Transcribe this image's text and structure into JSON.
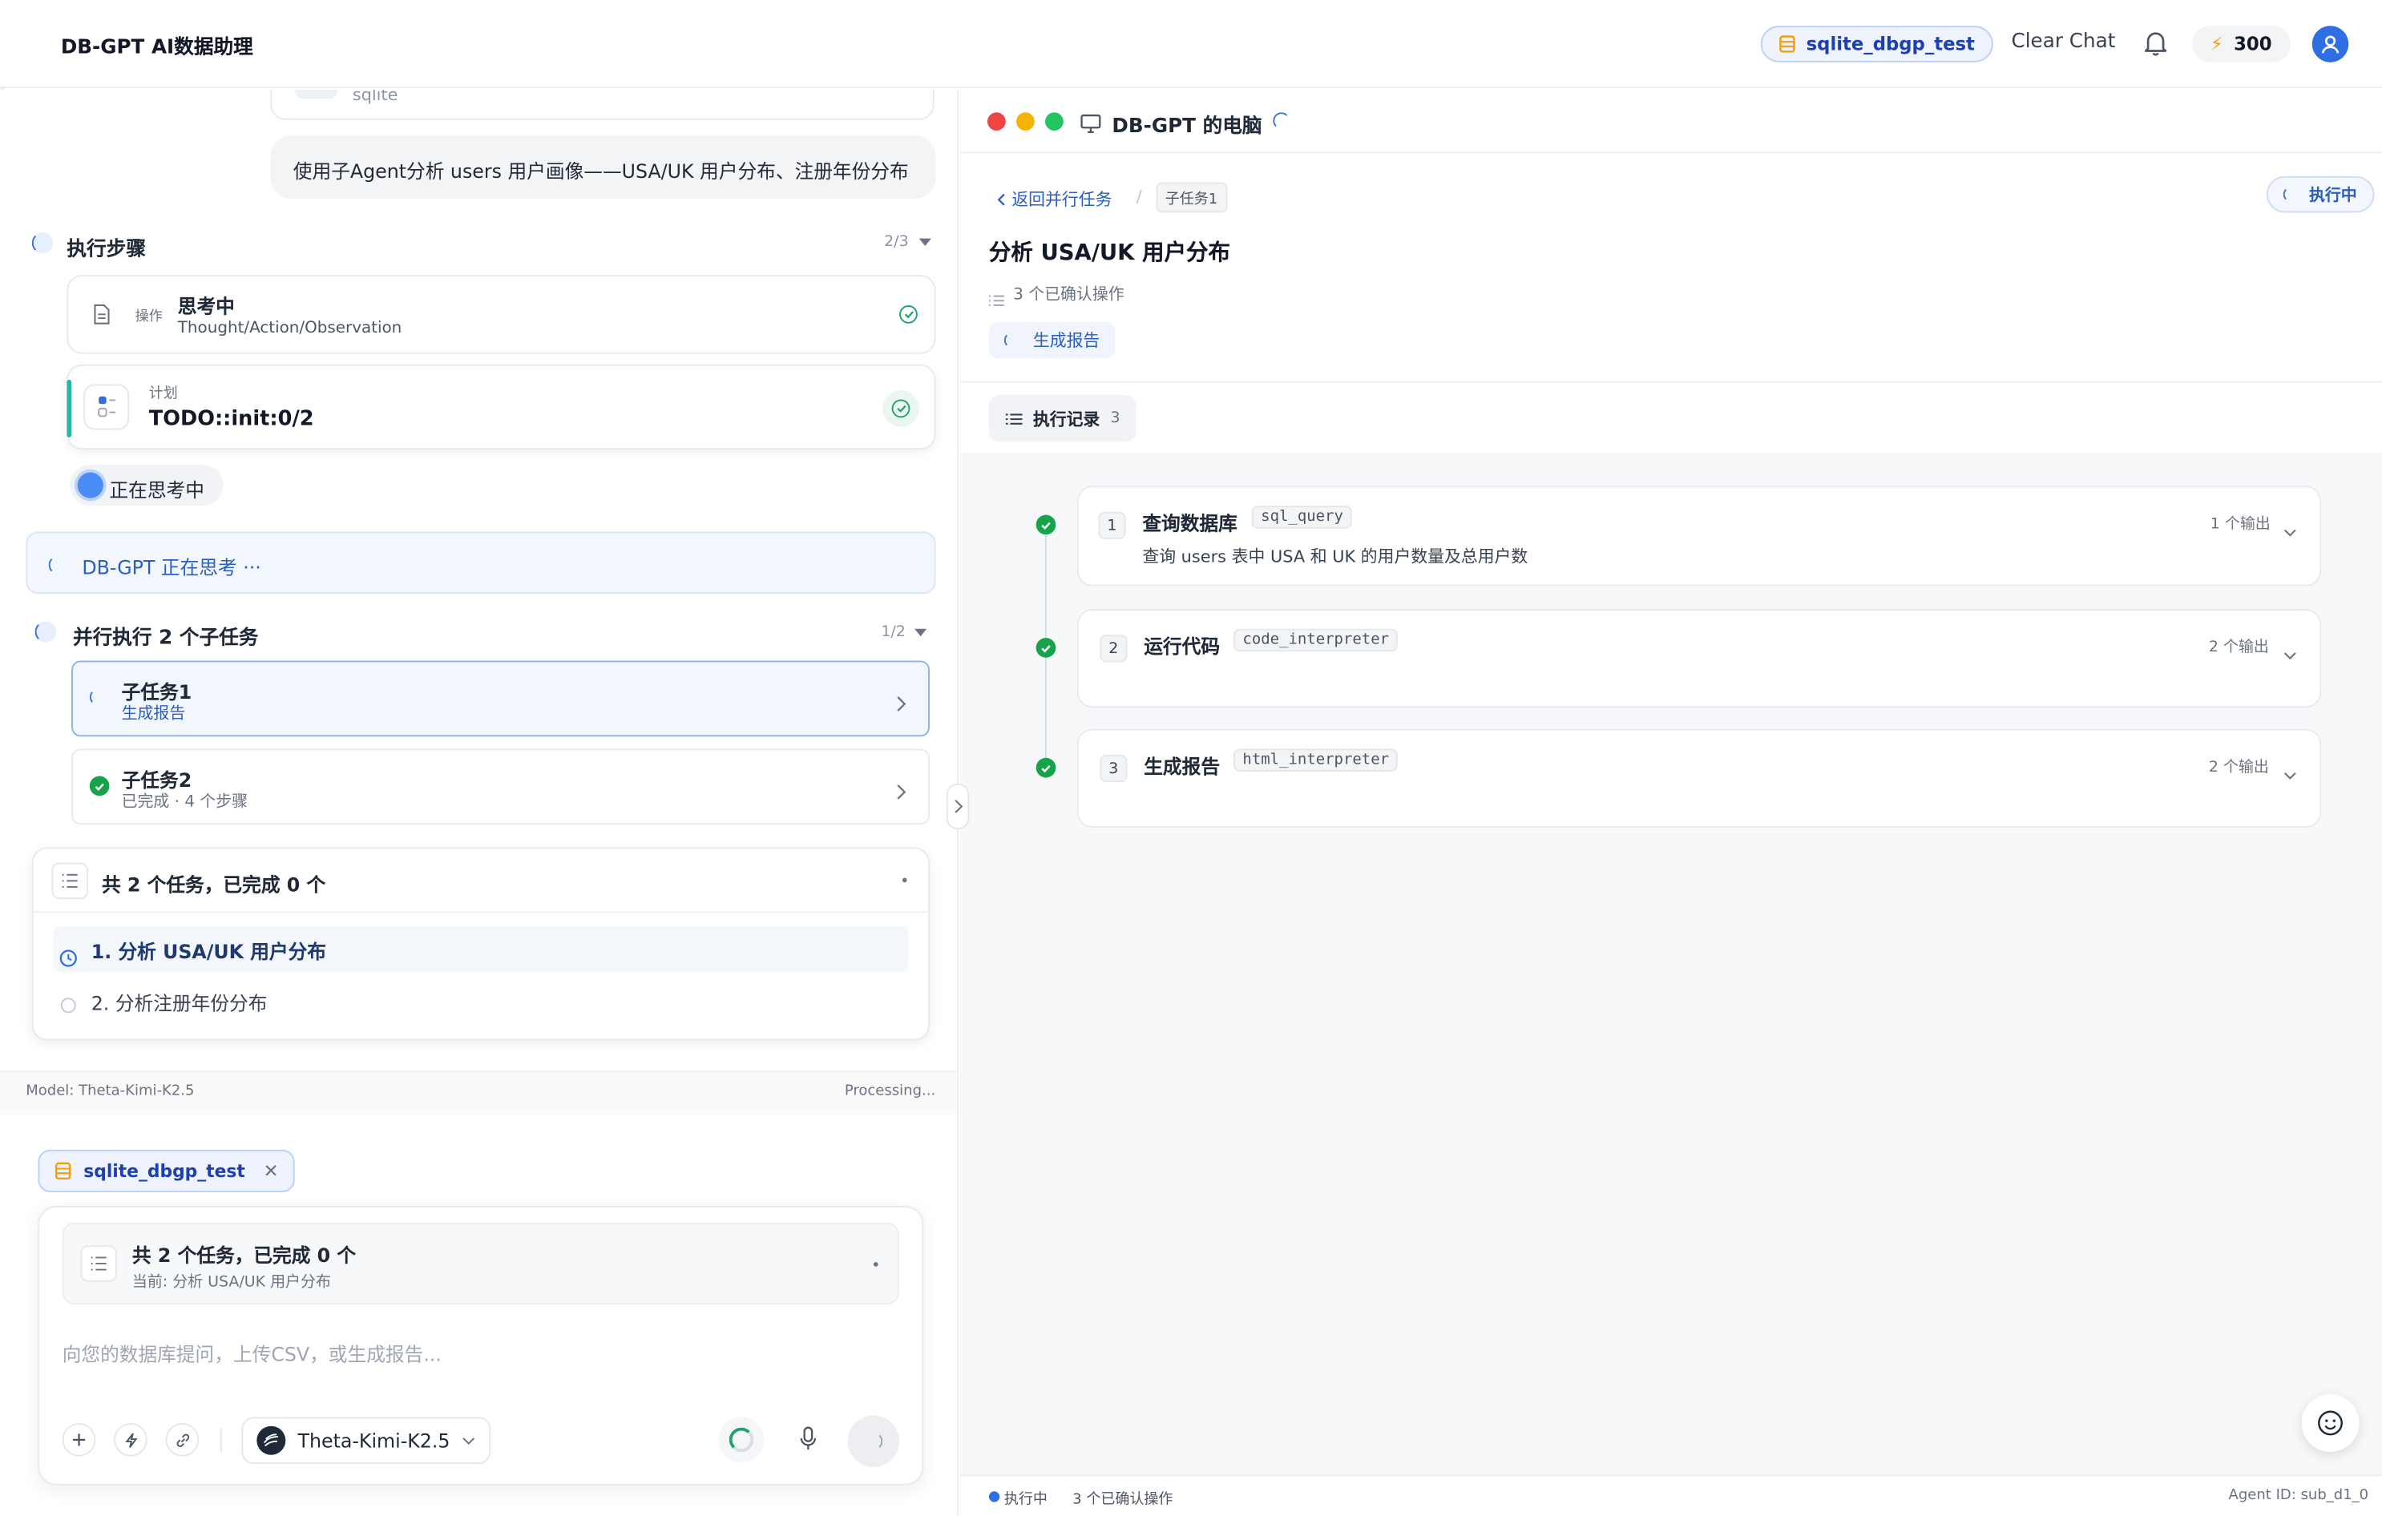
{
  "header": {
    "brand": "DB-GPT AI数据助理",
    "db_chip": "sqlite_dbgp_test",
    "clear_chat": "Clear Chat",
    "credits": "300"
  },
  "chat": {
    "prev_db_subtitle": "sqlite",
    "user_message": "使用子Agent分析 users 用户画像——USA/UK 用户分布、注册年份分布",
    "steps": {
      "title": "执行步骤",
      "count": "2/3",
      "op_tag": "操作",
      "op_title": "思考中",
      "op_sub": "Thought/Action/Observation",
      "plan_tag": "计划",
      "plan_title": "TODO::init:0/2",
      "thinking_pill": "正在思考中"
    },
    "thinking_bar": "DB-GPT 正在思考 ···",
    "parallel": {
      "title": "并行执行 2 个子任务",
      "count": "1/2",
      "tasks": [
        {
          "title": "子任务1",
          "sub": "生成报告"
        },
        {
          "title": "子任务2",
          "sub": "已完成 · 4 个步骤"
        }
      ]
    },
    "todo": {
      "title": "共 2 个任务，已完成 0 个",
      "items": [
        "1. 分析 USA/UK 用户分布",
        "2. 分析注册年份分布"
      ]
    },
    "status": {
      "model": "Model: Theta-Kimi-K2.5",
      "state": "Processing..."
    }
  },
  "composer": {
    "db_chip": "sqlite_dbgp_test",
    "todo_title": "共 2 个任务，已完成 0 个",
    "todo_current": "当前: 分析 USA/UK 用户分布",
    "placeholder": "向您的数据库提问，上传CSV，或生成报告...",
    "model": "Theta-Kimi-K2.5"
  },
  "computer": {
    "window_title": "DB-GPT 的电脑",
    "back": "返回并行任务",
    "crumb": "子任务1",
    "status_badge": "执行中",
    "title": "分析 USA/UK 用户分布",
    "confirmed": "3 个已确认操作",
    "action_chip": "生成报告",
    "log_tab": "执行记录",
    "log_count": "3",
    "steps": [
      {
        "n": "1",
        "name": "查询数据库",
        "tool": "sql_query",
        "outputs": "1 个输出",
        "desc": "查询 users 表中 USA 和 UK 的用户数量及总用户数"
      },
      {
        "n": "2",
        "name": "运行代码",
        "tool": "code_interpreter",
        "outputs": "2 个输出",
        "desc": ""
      },
      {
        "n": "3",
        "name": "生成报告",
        "tool": "html_interpreter",
        "outputs": "2 个输出",
        "desc": ""
      }
    ],
    "footer": {
      "status": "执行中",
      "confirmed": "3 个已确认操作",
      "agent_id": "Agent ID: sub_d1_0"
    }
  },
  "colors": {
    "accent": "#2f6fe4",
    "success": "#16a34a",
    "chip_bg": "#eef3fe"
  }
}
